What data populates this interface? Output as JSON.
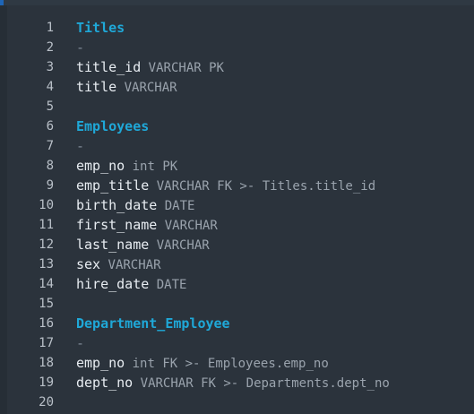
{
  "editor": {
    "lines": [
      {
        "n": "1",
        "name": "Titles",
        "rest": "",
        "kind": "head"
      },
      {
        "n": "2",
        "name": "-",
        "rest": "",
        "kind": "dash"
      },
      {
        "n": "3",
        "name": "title_id",
        "rest": " VARCHAR PK",
        "kind": "field"
      },
      {
        "n": "4",
        "name": "title",
        "rest": " VARCHAR",
        "kind": "field"
      },
      {
        "n": "5",
        "name": "",
        "rest": "",
        "kind": "empty"
      },
      {
        "n": "6",
        "name": "Employees",
        "rest": "",
        "kind": "head"
      },
      {
        "n": "7",
        "name": "-",
        "rest": "",
        "kind": "dash"
      },
      {
        "n": "8",
        "name": "emp_no",
        "rest": " int PK",
        "kind": "field"
      },
      {
        "n": "9",
        "name": "emp_title",
        "rest": " VARCHAR FK >- Titles.title_id",
        "kind": "field"
      },
      {
        "n": "10",
        "name": "birth_date",
        "rest": " DATE",
        "kind": "field"
      },
      {
        "n": "11",
        "name": "first_name",
        "rest": " VARCHAR",
        "kind": "field"
      },
      {
        "n": "12",
        "name": "last_name",
        "rest": " VARCHAR",
        "kind": "field"
      },
      {
        "n": "13",
        "name": "sex",
        "rest": " VARCHAR",
        "kind": "field"
      },
      {
        "n": "14",
        "name": "hire_date",
        "rest": " DATE",
        "kind": "field"
      },
      {
        "n": "15",
        "name": "",
        "rest": "",
        "kind": "empty"
      },
      {
        "n": "16",
        "name": "Department_Employee",
        "rest": "",
        "kind": "head"
      },
      {
        "n": "17",
        "name": "-",
        "rest": "",
        "kind": "dash"
      },
      {
        "n": "18",
        "name": "emp_no",
        "rest": " int FK >- Employees.emp_no",
        "kind": "field"
      },
      {
        "n": "19",
        "name": "dept_no",
        "rest": " VARCHAR FK >- Departments.dept_no",
        "kind": "field"
      },
      {
        "n": "20",
        "name": "",
        "rest": "",
        "kind": "empty"
      }
    ]
  }
}
